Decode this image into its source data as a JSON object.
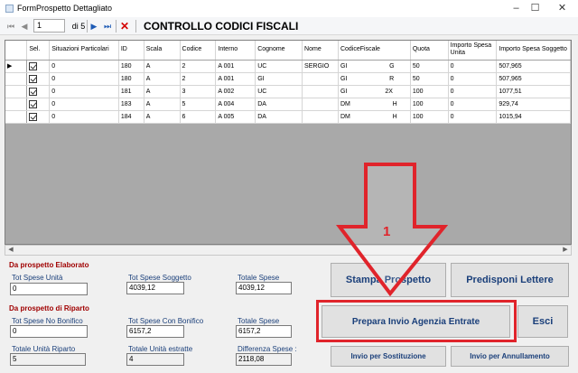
{
  "window": {
    "title": "FormProspetto Dettagliato",
    "controls": {
      "minimize": "–",
      "maximize": "☐",
      "close": "✕"
    }
  },
  "toolbar": {
    "first": "⏮",
    "prev": "◀",
    "position": "1",
    "of_label": "di 5",
    "next": "▶",
    "last": "⏭",
    "delete": "✕",
    "title": "CONTROLLO CODICI FISCALI"
  },
  "grid": {
    "columns": [
      "Sel.",
      "Situazioni Particolari",
      "ID",
      "Scala",
      "Codice",
      "Interno",
      "Cognome",
      "Nome",
      "CodiceFiscale",
      "Quota",
      "Importo Spesa Unita",
      "Importo Spesa Soggetto"
    ],
    "rows": [
      {
        "marker": "▶",
        "situazioni": "0",
        "id": "180",
        "scala": "A",
        "codice": "2",
        "interno": "A 001",
        "cognome": "UC",
        "nome": "SERGIO",
        "cf_start": "GI",
        "cf_end": "G",
        "quota": "50",
        "importo_unita": "0",
        "importo_soggetto": "507,965"
      },
      {
        "marker": "",
        "situazioni": "0",
        "id": "180",
        "scala": "A",
        "codice": "2",
        "interno": "A 001",
        "cognome": "GI",
        "nome": "",
        "cf_start": "GI",
        "cf_end": "R",
        "quota": "50",
        "importo_unita": "0",
        "importo_soggetto": "507,965"
      },
      {
        "marker": "",
        "situazioni": "0",
        "id": "181",
        "scala": "A",
        "codice": "3",
        "interno": "A 002",
        "cognome": "UC",
        "nome": "",
        "cf_start": "GI",
        "cf_end": "2X",
        "quota": "100",
        "importo_unita": "0",
        "importo_soggetto": "1077,51"
      },
      {
        "marker": "",
        "situazioni": "0",
        "id": "183",
        "scala": "A",
        "codice": "5",
        "interno": "A 004",
        "cognome": "DA",
        "nome": "",
        "cf_start": "DM",
        "cf_end": "H",
        "quota": "100",
        "importo_unita": "0",
        "importo_soggetto": "929,74"
      },
      {
        "marker": "",
        "situazioni": "0",
        "id": "184",
        "scala": "A",
        "codice": "6",
        "interno": "A 005",
        "cognome": "DA",
        "nome": "",
        "cf_start": "DM",
        "cf_end": "H",
        "quota": "100",
        "importo_unita": "0",
        "importo_soggetto": "1015,94"
      }
    ]
  },
  "scrollbar": {
    "left": "◀",
    "right": "▶"
  },
  "elaborato": {
    "section": "Da prospetto Elaborato",
    "tot_spese_unita_label": "Tot Spese Unità",
    "tot_spese_unita": "0",
    "tot_spese_soggetto_label": "Tot Spese Soggetto",
    "tot_spese_soggetto": "4039,12",
    "totale_spese_label": "Totale Spese",
    "totale_spese": "4039,12"
  },
  "riparto": {
    "section": "Da prospetto di Riparto",
    "no_bonifico_label": "Tot Spese No Bonifico",
    "no_bonifico": "0",
    "con_bonifico_label": "Tot Spese Con Bonifico",
    "con_bonifico": "6157,2",
    "totale_spese_label": "Totale Spese",
    "totale_spese": "6157,2",
    "unita_riparto_label": "Totale Unità Riparto",
    "unita_riparto": "5",
    "unita_estratte_label": "Totale Unità estratte",
    "unita_estratte": "4",
    "differenza_label": "Differenza Spese :",
    "differenza": "2118,08"
  },
  "buttons": {
    "stampa": "Stampa Prospetto",
    "predisponi": "Predisponi Lettere",
    "prepara": "Prepara Invio Agenzia Entrate",
    "esci": "Esci",
    "sostituzione": "Invio per Sostituzione",
    "annullamento": "Invio per Annullamento"
  },
  "annotation": {
    "number": "1",
    "color": "#e0242b"
  }
}
